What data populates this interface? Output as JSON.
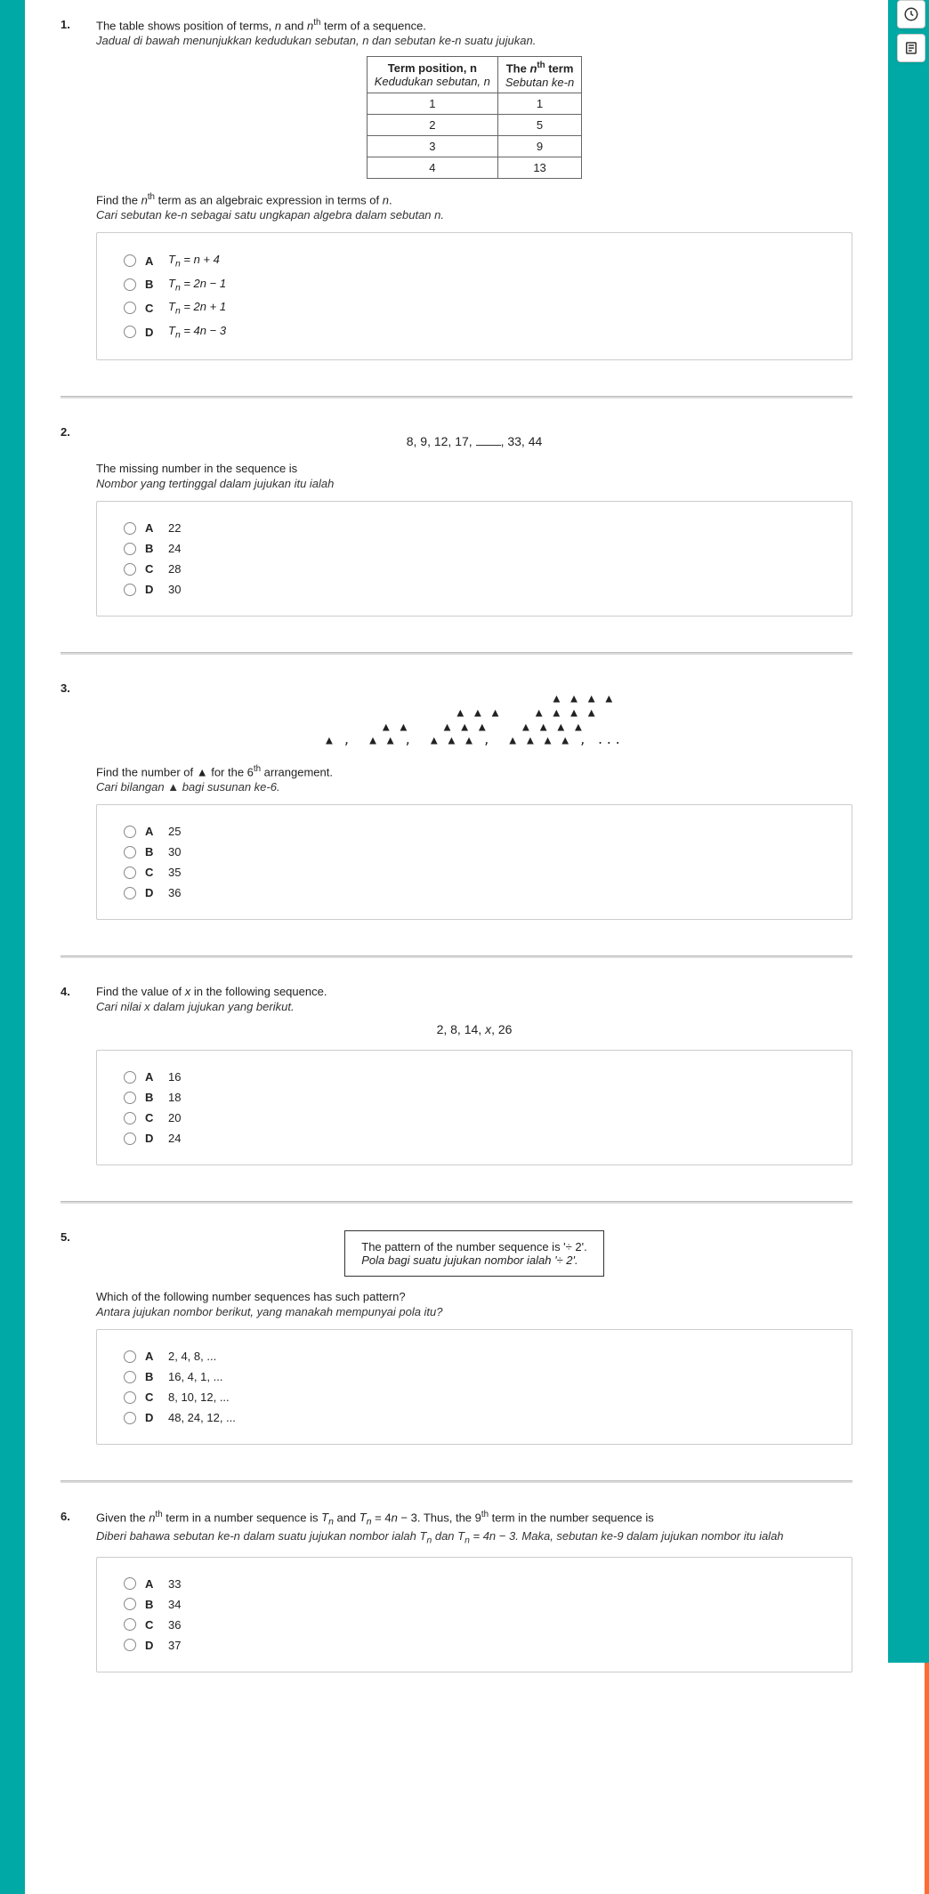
{
  "sidebar_icons": {
    "clock": "clock-icon",
    "note": "note-icon"
  },
  "q1": {
    "num": "1.",
    "en": "The table shows position of terms, n and nᵗʰ term of a sequence.",
    "ms": "Jadual di bawah menunjukkan kedudukan sebutan, n dan sebutan ke-n suatu jujukan.",
    "table": {
      "h1_en": "Term position, n",
      "h1_ms": "Kedudukan sebutan, n",
      "h2_en": "The nᵗʰ term",
      "h2_ms": "Sebutan ke-n",
      "rows": [
        {
          "pos": "1",
          "term": "1"
        },
        {
          "pos": "2",
          "term": "5"
        },
        {
          "pos": "3",
          "term": "9"
        },
        {
          "pos": "4",
          "term": "13"
        }
      ]
    },
    "find_en": "Find the nᵗʰ term as an algebraic expression in terms of n.",
    "find_ms": "Cari sebutan ke-n sebagai satu ungkapan algebra dalam sebutan n.",
    "opts": {
      "A": "Tₙ = n + 4",
      "B": "Tₙ = 2n − 1",
      "C": "Tₙ = 2n + 1",
      "D": "Tₙ = 4n − 3"
    }
  },
  "q2": {
    "num": "2.",
    "seq": "8, 9, 12, 17, ____, 33, 44",
    "en": "The missing number in the sequence is",
    "ms": "Nombor yang tertinggal dalam jujukan itu ialah",
    "opts": {
      "A": "22",
      "B": "24",
      "C": "28",
      "D": "30"
    }
  },
  "q3": {
    "num": "3.",
    "find_en": "Find the number of ▲ for the 6ᵗʰ arrangement.",
    "find_ms": "Cari bilangan ▲ bagi susunan ke-6.",
    "opts": {
      "A": "25",
      "B": "30",
      "C": "35",
      "D": "36"
    }
  },
  "q4": {
    "num": "4.",
    "en": "Find the value of x in the following sequence.",
    "ms": "Cari nilai x dalam jujukan yang berikut.",
    "seq": "2, 8, 14, x, 26",
    "opts": {
      "A": "16",
      "B": "18",
      "C": "20",
      "D": "24"
    }
  },
  "q5": {
    "num": "5.",
    "box_en": "The pattern of the number sequence is '÷ 2'.",
    "box_ms": "Pola bagi suatu jujukan nombor ialah '÷ 2'.",
    "en": "Which of the following number sequences has such pattern?",
    "ms": "Antara jujukan nombor berikut, yang manakah mempunyai pola itu?",
    "opts": {
      "A": "2, 4, 8, ...",
      "B": "16, 4, 1, ...",
      "C": "8, 10, 12, ...",
      "D": "48, 24, 12, ..."
    }
  },
  "q6": {
    "num": "6.",
    "en": "Given the nᵗʰ term in a number sequence is Tₙ and Tₙ = 4n − 3. Thus, the 9ᵗʰ term in the number sequence is",
    "ms": "Diberi bahawa sebutan ke-n dalam suatu jujukan nombor ialah Tₙ dan Tₙ = 4n − 3. Maka, sebutan ke-9 dalam jujukan nombor itu ialah",
    "opts": {
      "A": "33",
      "B": "34",
      "C": "36",
      "D": "37"
    }
  }
}
